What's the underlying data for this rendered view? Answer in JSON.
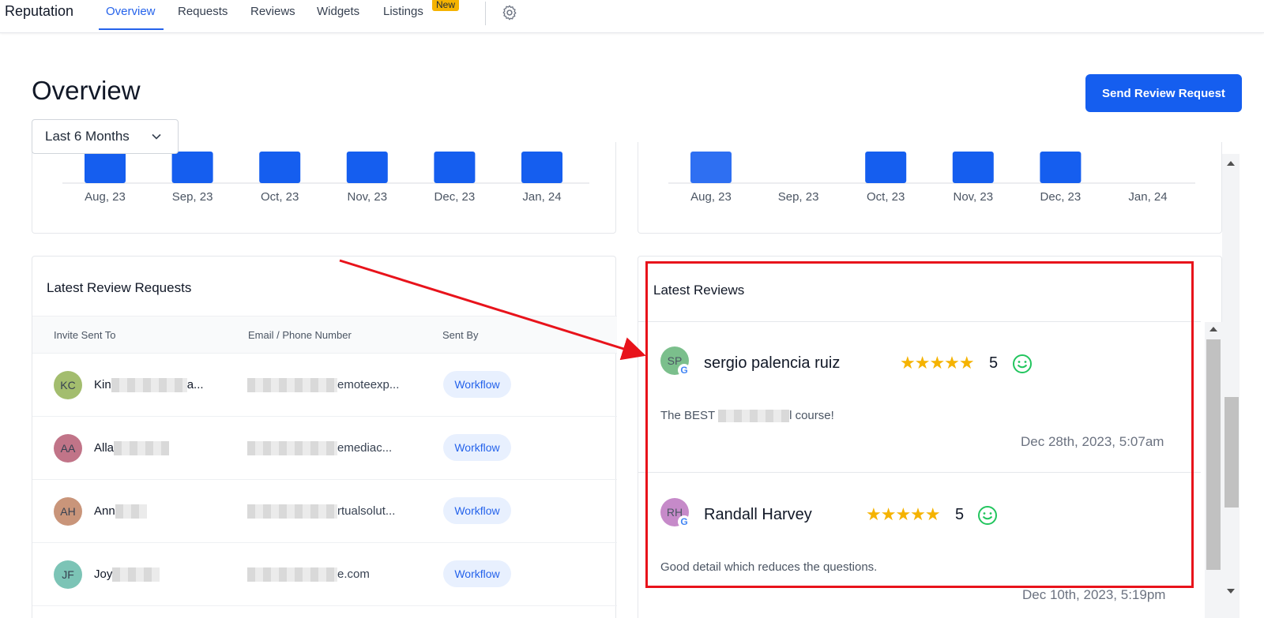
{
  "nav": {
    "brand": "Reputation",
    "tabs": [
      {
        "label": "Overview",
        "active": true
      },
      {
        "label": "Requests"
      },
      {
        "label": "Reviews"
      },
      {
        "label": "Widgets"
      },
      {
        "label": "Listings"
      }
    ],
    "new_badge": "New",
    "settings_icon": "gear-icon"
  },
  "header": {
    "title": "Overview",
    "send_button": "Send Review Request",
    "period": "Last 6 Months"
  },
  "colors": {
    "accent": "#155eef",
    "star": "#f5b301",
    "annotation": "#e8131b",
    "smile": "#22c55e"
  },
  "chart_data": [
    {
      "type": "bar",
      "categories": [
        "Aug, 23",
        "Sep, 23",
        "Oct, 23",
        "Nov, 23",
        "Dec, 23",
        "Jan, 24"
      ],
      "values": [
        1,
        1,
        1,
        1,
        1,
        1
      ]
    },
    {
      "type": "bar",
      "categories": [
        "Aug, 23",
        "Sep, 23",
        "Oct, 23",
        "Nov, 23",
        "Dec, 23",
        "Jan, 24"
      ],
      "values": [
        1,
        0,
        1,
        1,
        1,
        0
      ]
    }
  ],
  "requests": {
    "title": "Latest Review Requests",
    "columns": [
      "Invite Sent To",
      "Email / Phone Number",
      "Sent By"
    ],
    "rows": [
      {
        "initials": "KC",
        "avatar_color": "#a3bd6e",
        "name": "Kin",
        "name_tail": "a...",
        "email_tail": "emoteexp...",
        "sent_by": "Workflow"
      },
      {
        "initials": "AA",
        "avatar_color": "#c17488",
        "name": "Alla",
        "name_tail": "",
        "email_tail": "emediac...",
        "sent_by": "Workflow"
      },
      {
        "initials": "AH",
        "avatar_color": "#c9957a",
        "name": "Ann",
        "name_tail": "",
        "email_tail": "rtualsolut...",
        "sent_by": "Workflow"
      },
      {
        "initials": "JF",
        "avatar_color": "#7cc4b6",
        "name": "Joy",
        "name_tail": "",
        "email_tail": "e.com",
        "sent_by": "Workflow"
      }
    ]
  },
  "reviews": {
    "title": "Latest Reviews",
    "items": [
      {
        "initials": "SP",
        "avatar_color": "#7bbf8c",
        "name": "sergio palencia ruiz",
        "stars": "★★★★★",
        "rating": "5",
        "text_start": "The BEST",
        "text_end": "l course!",
        "date": "Dec 28th, 2023, 5:07am",
        "source_icon": "google-icon"
      },
      {
        "initials": "RH",
        "avatar_color": "#c68ac9",
        "name": "Randall Harvey",
        "stars": "★★★★★",
        "rating": "5",
        "text_start": "Good detail which reduces the questions.",
        "text_end": "",
        "date": "Dec 10th, 2023, 5:19pm",
        "source_icon": "google-icon"
      }
    ]
  }
}
